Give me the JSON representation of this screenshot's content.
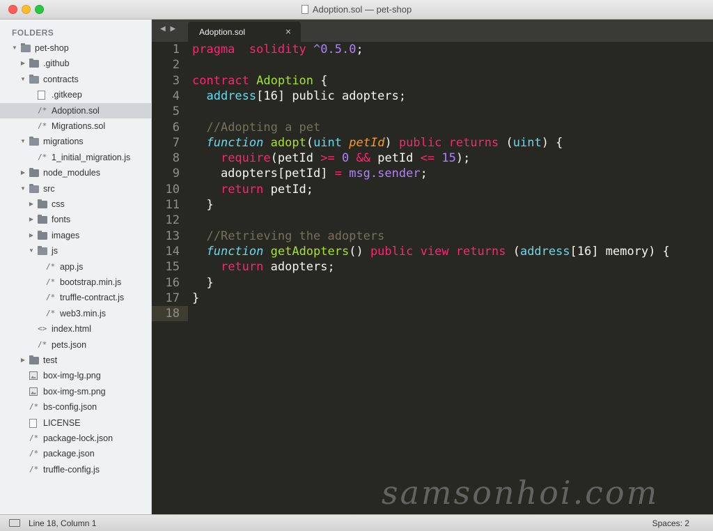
{
  "window": {
    "title": "Adoption.sol — pet-shop"
  },
  "sidebar": {
    "header": "FOLDERS",
    "tree": [
      {
        "label": "pet-shop",
        "kind": "folder-open",
        "depth": 0
      },
      {
        "label": ".github",
        "kind": "folder",
        "depth": 1
      },
      {
        "label": "contracts",
        "kind": "folder-open",
        "depth": 1
      },
      {
        "label": ".gitkeep",
        "kind": "file",
        "depth": 2
      },
      {
        "label": "Adoption.sol",
        "kind": "code",
        "depth": 2,
        "selected": true
      },
      {
        "label": "Migrations.sol",
        "kind": "code",
        "depth": 2
      },
      {
        "label": "migrations",
        "kind": "folder-open",
        "depth": 1
      },
      {
        "label": "1_initial_migration.js",
        "kind": "code",
        "depth": 2
      },
      {
        "label": "node_modules",
        "kind": "folder",
        "depth": 1
      },
      {
        "label": "src",
        "kind": "folder-open",
        "depth": 1
      },
      {
        "label": "css",
        "kind": "folder",
        "depth": 2
      },
      {
        "label": "fonts",
        "kind": "folder",
        "depth": 2
      },
      {
        "label": "images",
        "kind": "folder",
        "depth": 2
      },
      {
        "label": "js",
        "kind": "folder-open",
        "depth": 2
      },
      {
        "label": "app.js",
        "kind": "code",
        "depth": 3
      },
      {
        "label": "bootstrap.min.js",
        "kind": "code",
        "depth": 3
      },
      {
        "label": "truffle-contract.js",
        "kind": "code",
        "depth": 3
      },
      {
        "label": "web3.min.js",
        "kind": "code",
        "depth": 3
      },
      {
        "label": "index.html",
        "kind": "html",
        "depth": 2
      },
      {
        "label": "pets.json",
        "kind": "code",
        "depth": 2
      },
      {
        "label": "test",
        "kind": "folder",
        "depth": 1
      },
      {
        "label": "box-img-lg.png",
        "kind": "image",
        "depth": 1
      },
      {
        "label": "box-img-sm.png",
        "kind": "image",
        "depth": 1
      },
      {
        "label": "bs-config.json",
        "kind": "code",
        "depth": 1
      },
      {
        "label": "LICENSE",
        "kind": "file",
        "depth": 1
      },
      {
        "label": "package-lock.json",
        "kind": "code",
        "depth": 1
      },
      {
        "label": "package.json",
        "kind": "code",
        "depth": 1
      },
      {
        "label": "truffle-config.js",
        "kind": "code",
        "depth": 1
      }
    ]
  },
  "tabs": {
    "nav_arrows": "◀ ▶",
    "active_label": "Adoption.sol",
    "close_glyph": "×"
  },
  "editor": {
    "current_line": 18,
    "lines": [
      [
        [
          "k",
          "pragma"
        ],
        [
          "",
          "  "
        ],
        [
          "k",
          "solidity"
        ],
        [
          "",
          " "
        ],
        [
          "n",
          "^0.5.0"
        ],
        [
          "",
          ";"
        ]
      ],
      [],
      [
        [
          "k",
          "contract"
        ],
        [
          "",
          " "
        ],
        [
          "f",
          "Adoption"
        ],
        [
          "",
          " {"
        ]
      ],
      [
        [
          "",
          "  "
        ],
        [
          "b",
          "address"
        ],
        [
          "",
          "[16] public adopters;"
        ]
      ],
      [],
      [
        [
          "",
          "  "
        ],
        [
          "c",
          "//Adopting a pet"
        ]
      ],
      [
        [
          "",
          "  "
        ],
        [
          "t",
          "function"
        ],
        [
          "",
          " "
        ],
        [
          "f",
          "adopt"
        ],
        [
          "",
          "("
        ],
        [
          "b",
          "uint"
        ],
        [
          "",
          " "
        ],
        [
          "p",
          "petId"
        ],
        [
          "",
          ") "
        ],
        [
          "k",
          "public"
        ],
        [
          "",
          " "
        ],
        [
          "k",
          "returns"
        ],
        [
          "",
          " ("
        ],
        [
          "b",
          "uint"
        ],
        [
          "",
          ") {"
        ]
      ],
      [
        [
          "",
          "    "
        ],
        [
          "k",
          "require"
        ],
        [
          "",
          "(petId "
        ],
        [
          "o",
          ">="
        ],
        [
          "",
          " "
        ],
        [
          "n",
          "0"
        ],
        [
          "",
          " "
        ],
        [
          "o",
          "&&"
        ],
        [
          "",
          " petId "
        ],
        [
          "o",
          "<="
        ],
        [
          "",
          " "
        ],
        [
          "n",
          "15"
        ],
        [
          "",
          ");"
        ]
      ],
      [
        [
          "",
          "    adopters[petId] "
        ],
        [
          "o",
          "="
        ],
        [
          "",
          " "
        ],
        [
          "v",
          "msg.sender"
        ],
        [
          "",
          ";"
        ]
      ],
      [
        [
          "",
          "    "
        ],
        [
          "k",
          "return"
        ],
        [
          "",
          " petId;"
        ]
      ],
      [
        [
          "",
          "  }"
        ]
      ],
      [],
      [
        [
          "",
          "  "
        ],
        [
          "c",
          "//Retrieving the adopters"
        ]
      ],
      [
        [
          "",
          "  "
        ],
        [
          "t",
          "function"
        ],
        [
          "",
          " "
        ],
        [
          "f",
          "getAdopters"
        ],
        [
          "",
          "() "
        ],
        [
          "k",
          "public"
        ],
        [
          "",
          " "
        ],
        [
          "k",
          "view"
        ],
        [
          "",
          " "
        ],
        [
          "k",
          "returns"
        ],
        [
          "",
          " ("
        ],
        [
          "b",
          "address"
        ],
        [
          "",
          "[16] memory) {"
        ]
      ],
      [
        [
          "",
          "    "
        ],
        [
          "k",
          "return"
        ],
        [
          "",
          " adopters;"
        ]
      ],
      [
        [
          "",
          "  }"
        ]
      ],
      [
        [
          "",
          "}"
        ]
      ],
      []
    ]
  },
  "watermark": "samsonhoi.com",
  "status": {
    "position": "Line 18, Column 1",
    "indent": "Spaces: 2"
  }
}
